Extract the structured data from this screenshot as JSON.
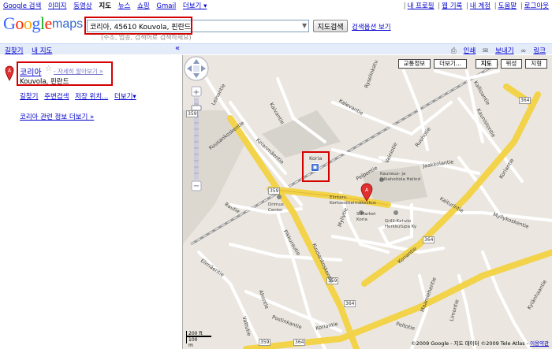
{
  "topbar": {
    "left": [
      "Google 검색",
      "이미지",
      "동영상",
      "지도",
      "뉴스",
      "쇼핑",
      "Gmail",
      "더보기 ▾"
    ],
    "right": [
      "내 프로필",
      "웹 기록",
      "내 계정",
      "도움말",
      "로그아웃"
    ]
  },
  "header": {
    "logo": "Google",
    "maps": "maps",
    "search_value": "코리아, 45610 Kouvola, 핀란드",
    "search_hint": "(주소, 업종, 검색어로 검색하세요)",
    "search_button": "지도검색",
    "search_options": "검색옵션 보기"
  },
  "bluebar": {
    "tabs": [
      "길찾기",
      "내 지도"
    ],
    "collapse": "«",
    "print": "인쇄",
    "send": "보내기",
    "link": "링크"
  },
  "result": {
    "title": "코리아",
    "star": "☆",
    "more_info": "- 자세히 알아보기 »",
    "address": "Kouvola, 핀란드",
    "actions": [
      "길찾기",
      "주변검색",
      "저장 위치...",
      "더보기▾"
    ],
    "related": "코리아 관련 정보 더보기 »"
  },
  "map": {
    "buttons": [
      "교통정보",
      "더보기...",
      "지도",
      "위성",
      "지형"
    ],
    "active_button": "지도",
    "scale_ft": "200 ft",
    "scale_m": "100 m",
    "copyright": "©2009 Google - 지도 데이터 ©2009 Tele Atlas - ",
    "terms": "이용약관",
    "labels": {
      "kouvola_station": "Koria",
      "kauppakeskus": "Elintarv. Kertoesittelmäkeskus",
      "drimus": "Drimus Center",
      "smarket": "S-Market Koria",
      "grilli": "Grilli-Kahvio Herkkutupa Ky",
      "kauneus": "Kauneus- ja jalkahoitola Helind",
      "kuusankoskentie": "Kuusankoskentie",
      "kuusankoskentie2": "Kuusankoskentie",
      "koriantie": "Koriantie",
      "koriantie2": "Koriantie",
      "koriantie3": "Koriantie",
      "kalevankatu": "Kalevantie",
      "keinontie": "Kelanmäentie",
      "kaivantie": "Kaivantie",
      "leinonkatu": "Leinontie",
      "rautatie": "Rautie",
      "piikkikatu": "Pikkurautie",
      "elimaentie": "Elimäentie",
      "postinkantie": "Postinkantie",
      "ahonkatu": "Ahontie",
      "vattukatu": "Vattutie",
      "myllykoskentie": "Myllykoskentie",
      "maamiehentie": "Maamiehentie",
      "kylanhaantie": "Kylänhaantie",
      "limontie": "Limontie",
      "peltotie": "Peltotie",
      "jaakkolantie": "Jaakkolantie",
      "ruohotie": "Ruohotie",
      "vainiotie": "Vainiotie",
      "kallionsalmi": "Kallioantie",
      "kaunasantie": "Kaunistontie",
      "ryselinkatu": "Ryselinkatu",
      "peipontie": "Peipontie",
      "kaiteri": "Kaiturintie",
      "mylly": "Myllytie"
    },
    "shields": [
      "359",
      "359",
      "359",
      "359",
      "364",
      "364",
      "364",
      "364"
    ]
  }
}
